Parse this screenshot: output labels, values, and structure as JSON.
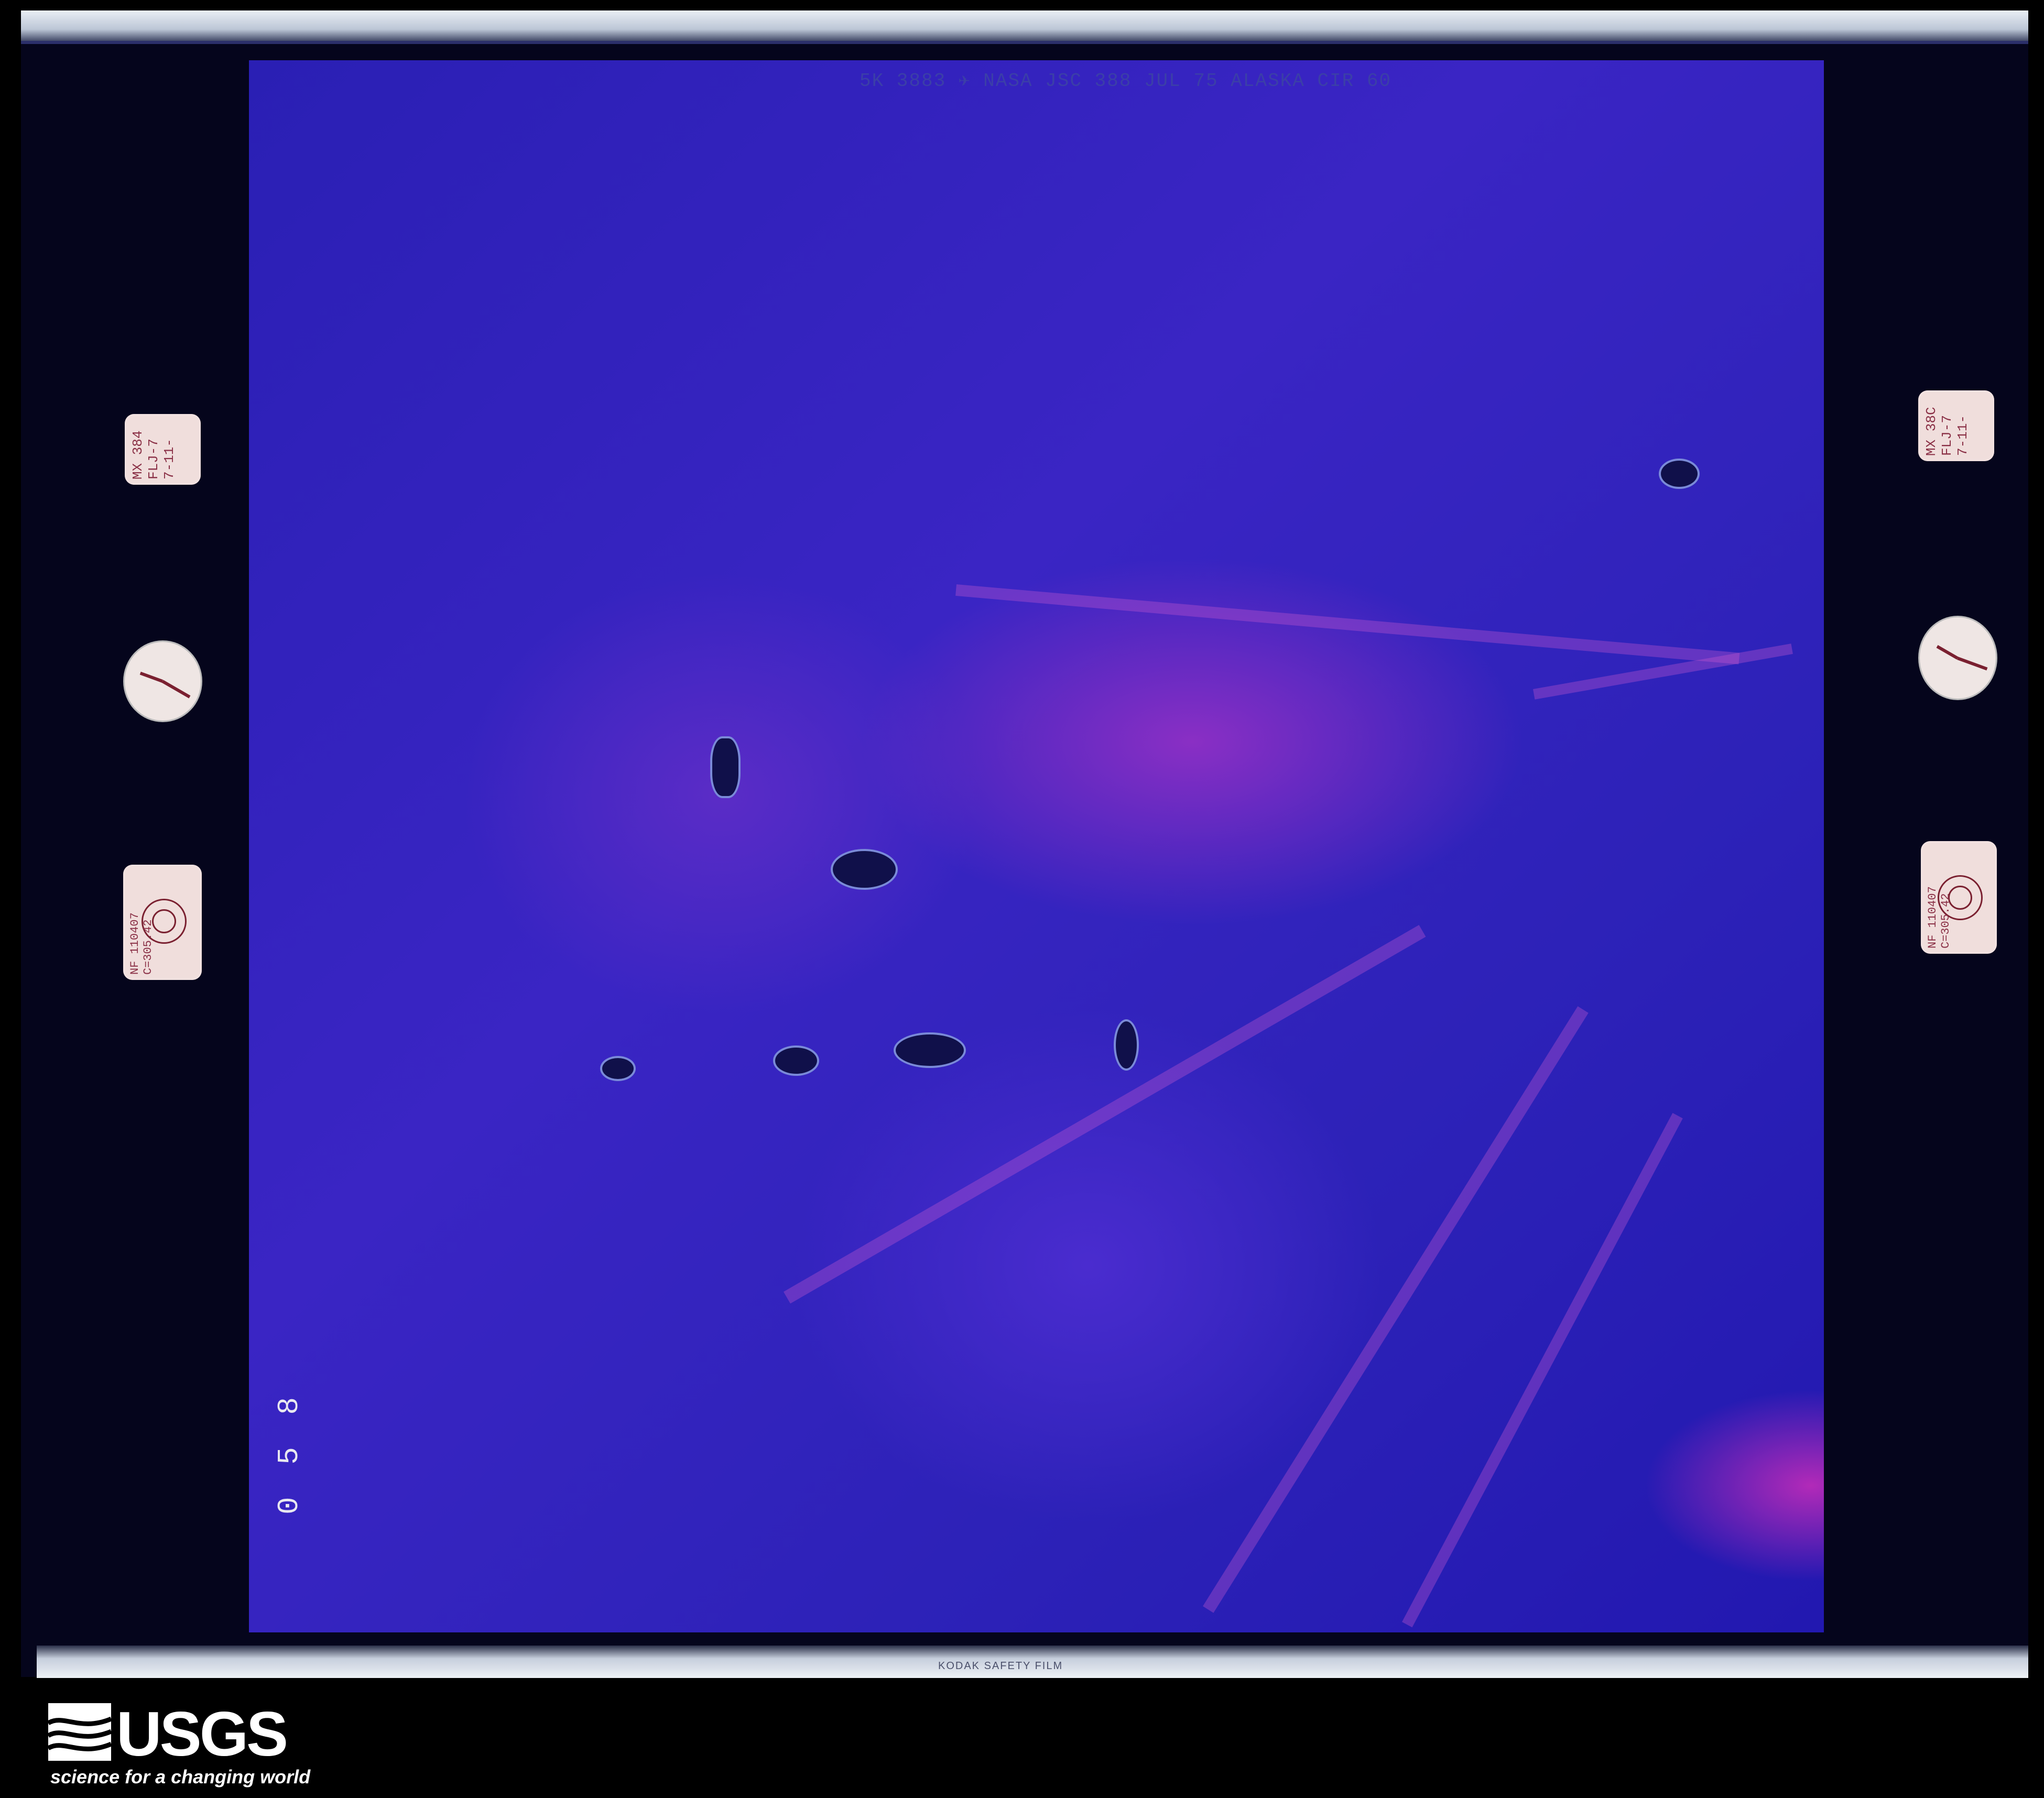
{
  "photo": {
    "frame_label": "5K 3883        ✈ NASA JSC 388  JUL 75  ALASKA  CIR 60",
    "frame_number": "0 5 8",
    "film_brand": "KODAK SAFETY FILM"
  },
  "left_cards": {
    "mission_card": "MX 384\nFLJ-7\n7-11-",
    "target_card": "NF 110407\nC=305.42"
  },
  "right_cards": {
    "mission_card": "MX 38C\nFLJ-7\n7-11-",
    "target_card": "NF 110407\nC=305.42"
  },
  "logo": {
    "wordmark": "USGS",
    "tagline": "science for a changing world"
  },
  "colors": {
    "film_background": "#05051c",
    "image_dominant": "#2a1fb4",
    "image_highlight": "#8a2fc4",
    "logo": "#ffffff"
  }
}
